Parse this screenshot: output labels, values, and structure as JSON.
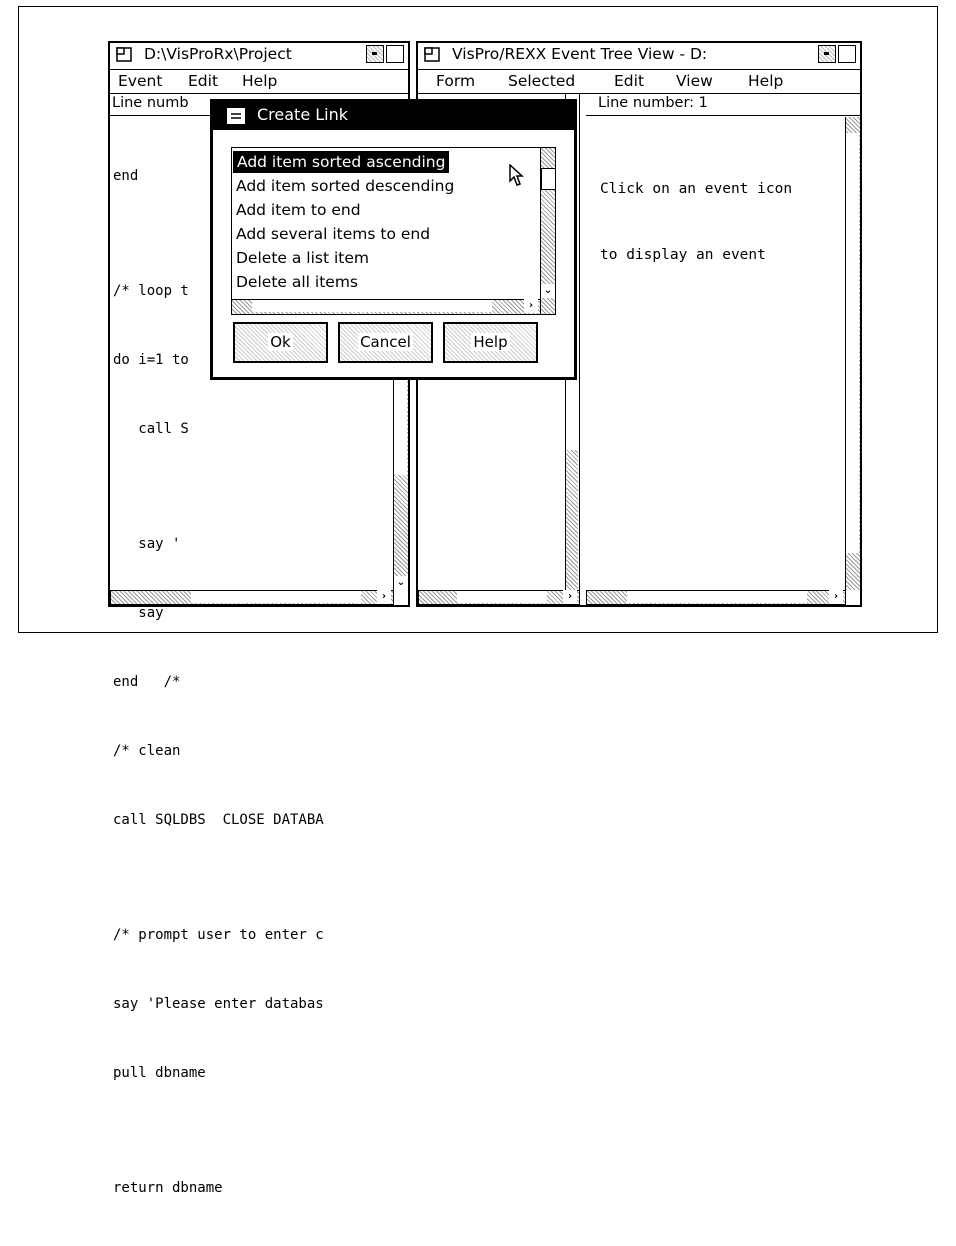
{
  "left_window": {
    "title": "D:\\VisProRx\\Project",
    "menu": [
      "Event",
      "Edit",
      "Help"
    ],
    "info": "Line numb",
    "code_lines": [
      "end",
      "",
      "/* loop t",
      "do i=1 to",
      "   call S",
      "",
      "   say '",
      "   say",
      "end   /*",
      "/* clean",
      "call SQLDBS  CLOSE DATABA",
      "",
      "/* prompt user to enter c",
      "say 'Please enter databas",
      "pull dbname",
      "",
      "return dbname"
    ]
  },
  "right_window": {
    "title": "VisPro/REXX Event Tree View - D:",
    "menu": [
      "Form",
      "Selected",
      "Edit",
      "View",
      "Help"
    ],
    "info": "Line number: 1",
    "message_lines": [
      "Click on an event icon",
      "to display an event"
    ]
  },
  "dialog": {
    "title": "Create Link",
    "items": [
      "Add item sorted ascending",
      "Add item sorted descending",
      "Add item to end",
      "Add several items to end",
      "Delete a list item",
      "Delete all items"
    ],
    "selected_index": 0,
    "buttons": {
      "ok": "Ok",
      "cancel": "Cancel",
      "help": "Help"
    }
  },
  "icons": {
    "scroll_right": "›",
    "scroll_down": "⌄"
  }
}
